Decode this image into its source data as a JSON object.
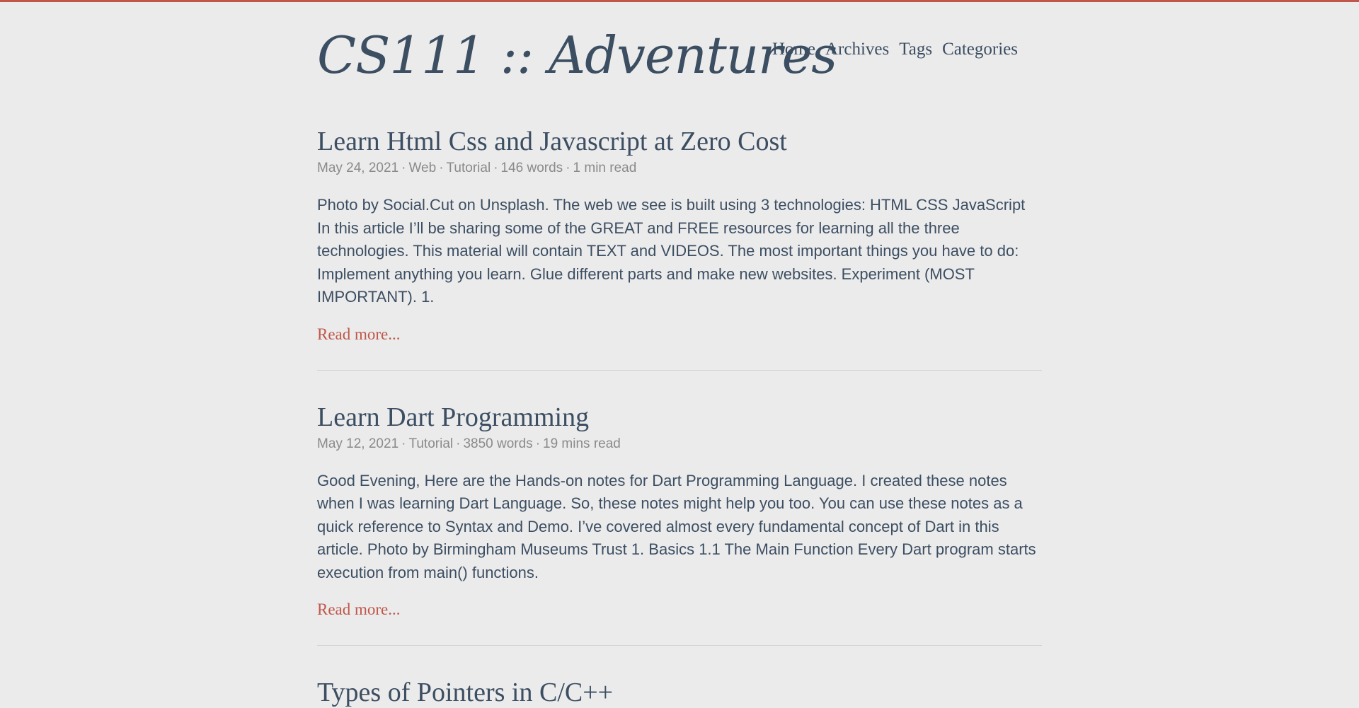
{
  "site": {
    "title": "CS111 :: Adventures",
    "accent_color": "#c0574a",
    "text_color": "#3c4e62",
    "background_color": "#ebebeb"
  },
  "nav": {
    "items": [
      "Home",
      "Archives",
      "Tags",
      "Categories"
    ]
  },
  "posts": [
    {
      "title": "Learn Html Css and Javascript at Zero Cost",
      "date": "May 24, 2021",
      "categories": [
        "Web",
        "Tutorial"
      ],
      "words": "146 words",
      "read_time": "1 min read",
      "summary": "Photo by Social.Cut on Unsplash. The web we see is built using 3 technologies: HTML CSS JavaScript In this article I’ll be sharing some of the GREAT and FREE resources for learning all the three technologies. This material will contain TEXT and VIDEOS. The most important things you have to do: Implement anything you learn. Glue different parts and make new websites. Experiment (MOST IMPORTANT). 1.",
      "read_more": "Read more..."
    },
    {
      "title": "Learn Dart Programming",
      "date": "May 12, 2021",
      "categories": [
        "Tutorial"
      ],
      "words": "3850 words",
      "read_time": "19 mins read",
      "summary": "Good Evening, Here are the Hands-on notes for Dart Programming Language. I created these notes when I was learning Dart Language. So, these notes might help you too. You can use these notes as a quick reference to Syntax and Demo. I’ve covered almost every fundamental concept of Dart in this article. Photo by Birmingham Museums Trust 1. Basics 1.1 The Main Function Every Dart program starts execution from main() functions.",
      "read_more": "Read more..."
    },
    {
      "title": "Types of Pointers in C/C++"
    }
  ]
}
